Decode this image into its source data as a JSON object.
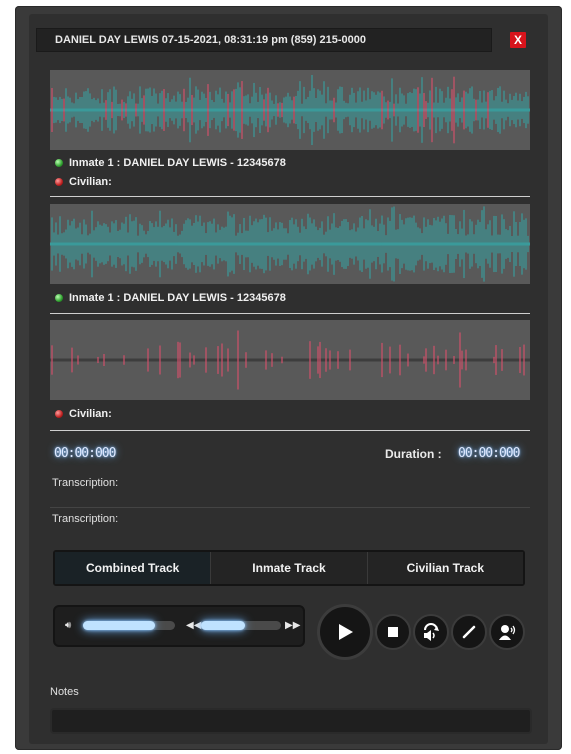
{
  "header": {
    "title": "DANIEL DAY LEWIS 07-15-2021,  08:31:19 pm  (859) 215-0000",
    "close_label": "X"
  },
  "channels": {
    "combined_inmate_label": "Inmate 1 : DANIEL DAY LEWIS - 12345678",
    "combined_civilian_label": "Civilian:",
    "inmate_label": "Inmate 1 : DANIEL DAY LEWIS - 12345678",
    "civilian_label": "Civilian:"
  },
  "timer": {
    "position": "00:00:000",
    "duration_label": "Duration :",
    "duration": "00:00:000"
  },
  "transcription": {
    "label_1": "Transcription:",
    "label_2": "Transcription:"
  },
  "tabs": [
    {
      "label": "Combined Track",
      "active": true
    },
    {
      "label": "Inmate Track",
      "active": false
    },
    {
      "label": "Civilian Track",
      "active": false
    }
  ],
  "player": {
    "volume_level": 0.78,
    "seek_level": 0.55,
    "icons": [
      "volume-icon",
      "rewind-icon",
      "fast-forward-icon",
      "play-icon",
      "stop-icon",
      "loop-audio-icon",
      "edit-icon",
      "voice-icon"
    ]
  },
  "notes": {
    "label": "Notes",
    "value": ""
  },
  "colors": {
    "inmate_wave": "#3a9a9a",
    "civilian_wave": "#d0506a",
    "panel": "#2f2f2f",
    "close": "#d8141c"
  }
}
